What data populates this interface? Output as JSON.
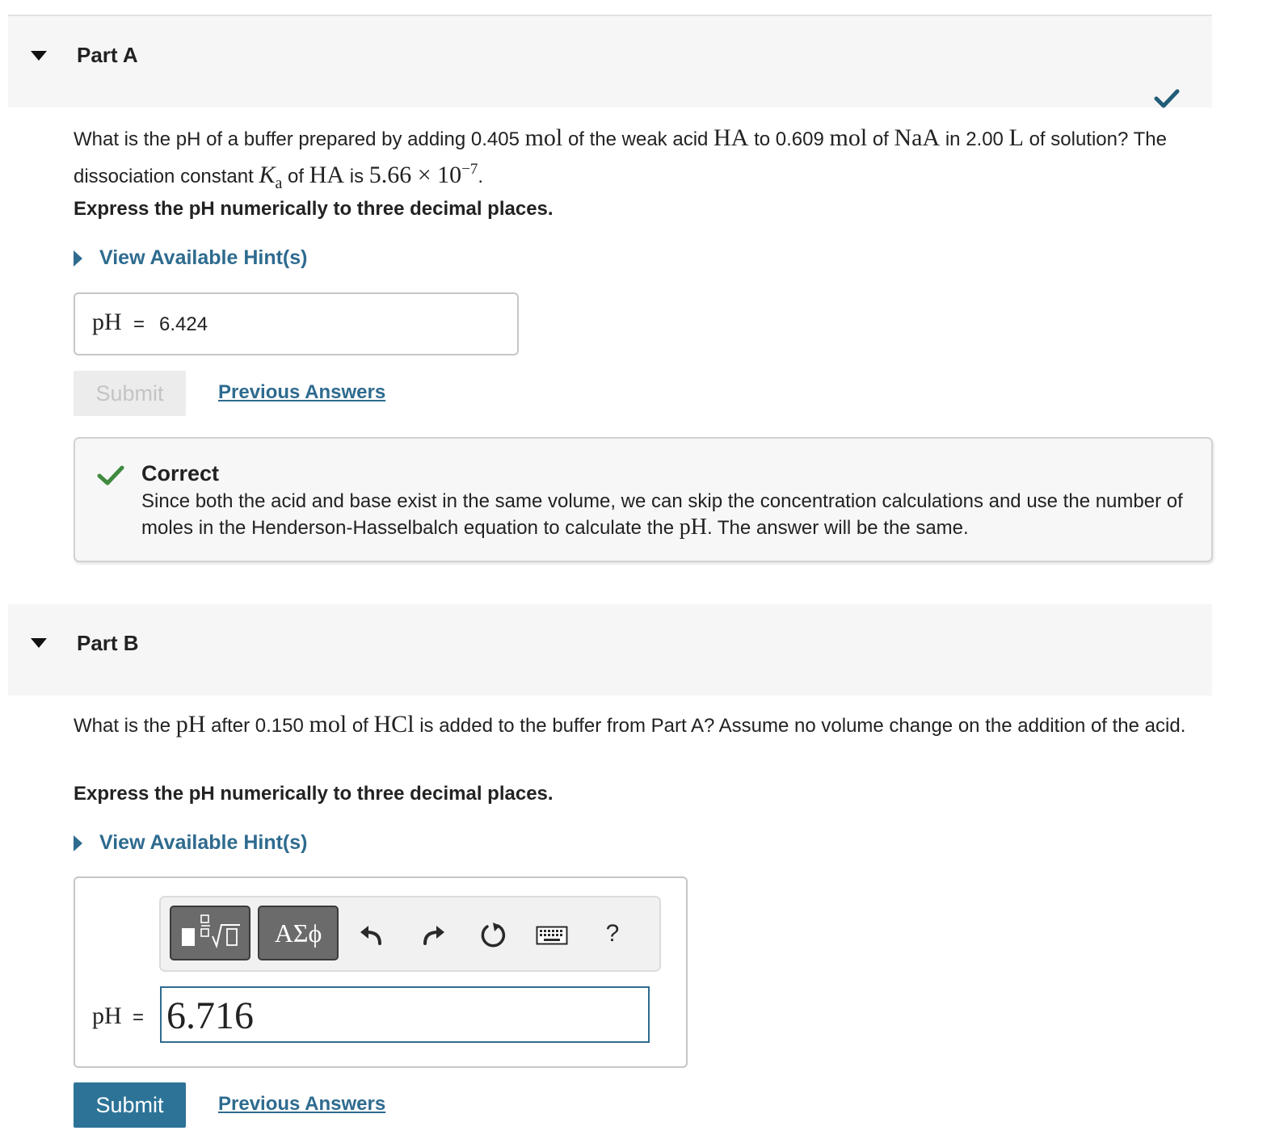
{
  "colors": {
    "link": "#2e6b8f",
    "submit": "#2c7397",
    "correct": "#3e8a3e",
    "check_header": "#215d79"
  },
  "partA": {
    "title": "Part A",
    "q1": "What is the pH of a buffer prepared by adding 0.405",
    "mol1": "mol",
    "q2": "of the weak acid",
    "ha1": "HA",
    "q3": "to 0.609",
    "mol2": "mol",
    "q4": "of",
    "naa": "NaA",
    "q5": "in 2.00",
    "liter": "L",
    "q6": "of solution? The dissociation constant",
    "ka_k": "K",
    "ka_sub": "a",
    "q7": "of",
    "ha2": "HA",
    "q8": "is",
    "ka_val": "5.66 × 10",
    "ka_exp": "−7",
    "q9": ".",
    "express": "Express the pH numerically to three decimal places.",
    "hint": "View Available Hint(s)",
    "answer_label": "pH",
    "answer_eq": "=",
    "answer_value": "6.424",
    "submit": "Submit",
    "previous": "Previous Answers",
    "feedback_title": "Correct",
    "fb1": "Since both the acid and base exist in the same volume, we can skip the concentration calculations and use the number of moles in the Henderson-Hasselbalch equation to calculate the",
    "fb_ph": "pH",
    "fb2": ". The answer will be the same."
  },
  "partB": {
    "title": "Part B",
    "q1": "What is the",
    "ph": "pH",
    "q2": "after 0.150",
    "mol": "mol",
    "q3": "of",
    "hcl": "HCl",
    "q4": "is added to the buffer from Part A? Assume no volume change on the addition of the acid.",
    "express": "Express the pH numerically to three decimal places.",
    "hint": "View Available Hint(s)",
    "greek_label": "ΑΣϕ",
    "help_label": "?",
    "answer_label": "pH",
    "answer_eq": "=",
    "answer_value": "6.716",
    "submit": "Submit",
    "previous": "Previous Answers"
  }
}
